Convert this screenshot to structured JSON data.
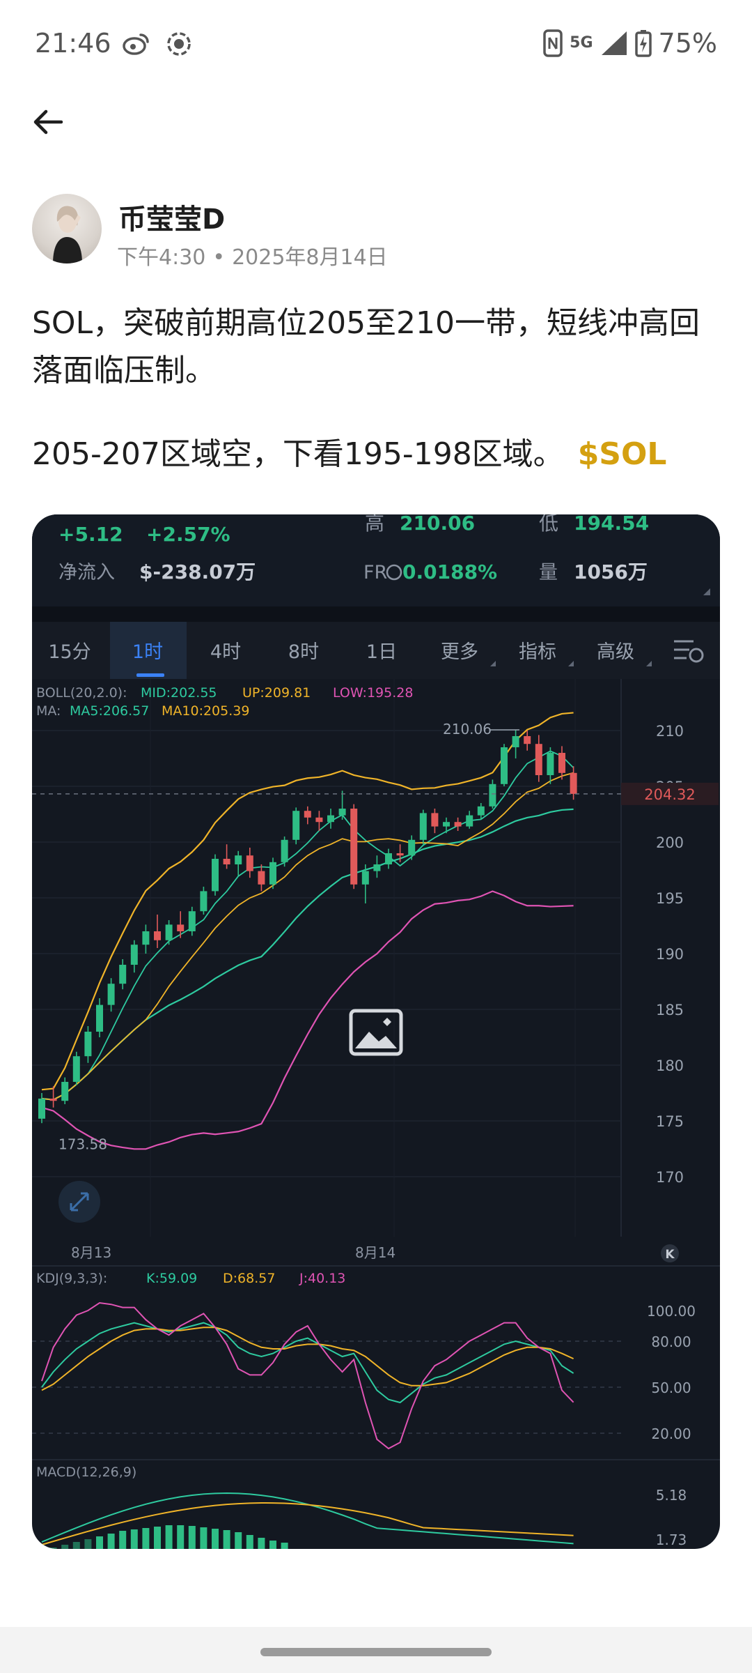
{
  "status_bar": {
    "time": "21:46",
    "network": "5G",
    "battery": "75%"
  },
  "post": {
    "author": "币莹莹D",
    "time": "下午4:30",
    "date": "2025年8月14日",
    "paragraph1": "SOL，突破前期高位205至210一带，短线冲高回落面临压制。",
    "paragraph2": "205-207区域空，下看195-198区域。",
    "ticker": "$SOL"
  },
  "chart": {
    "stats": {
      "change_abs": "+5.12",
      "change_pct": "+2.57%",
      "high_label": "高",
      "high": "210.06",
      "low_label": "低",
      "low": "194.54",
      "netflow_label": "净流入",
      "netflow": "$-238.07万",
      "fr_label": "FR",
      "fr": "0.0188%",
      "vol_label": "量",
      "vol": "1056万"
    },
    "tabs": [
      "15分",
      "1时",
      "4时",
      "8时",
      "1日",
      "更多",
      "指标",
      "高级"
    ],
    "active_tab": "1时",
    "boll": {
      "label": "BOLL(20,2.0):",
      "mid": "MID:202.55",
      "up": "UP:209.81",
      "low": "LOW:195.28"
    },
    "ma": {
      "label": "MA:",
      "ma5": "MA5:206.57",
      "ma10": "MA10:205.39"
    },
    "price_marker": "204.32",
    "high_marker": "210.06",
    "low_marker": "173.58",
    "date_ticks": [
      "8月13",
      "8月14"
    ],
    "kdj": {
      "label": "KDJ(9,3,3):",
      "k": "K:59.09",
      "d": "D:68.57",
      "j": "J:40.13"
    },
    "macd_label": "MACD(12,26,9)",
    "colors": {
      "up": "#2ebd85",
      "down": "#e15a5a",
      "mid": "#2ecba0",
      "upper": "#f0b429",
      "lower": "#e054b4",
      "accent": "#d4a010"
    }
  },
  "chart_data": [
    {
      "type": "candlestick",
      "title": "SOL 1时",
      "ylim": [
        168,
        212
      ],
      "y_ticks": [
        210,
        205,
        200,
        195,
        190,
        185,
        180,
        175,
        170
      ],
      "x_labels": [
        "8月13",
        "8月14"
      ],
      "current_price": 204.32,
      "candles": [
        [
          175.2,
          177.5,
          174.8,
          177.0
        ],
        [
          177.0,
          178.1,
          176.2,
          176.8
        ],
        [
          176.8,
          178.9,
          176.5,
          178.5
        ],
        [
          178.5,
          181.2,
          178.2,
          180.8
        ],
        [
          180.8,
          183.5,
          180.2,
          183.0
        ],
        [
          183.0,
          186.0,
          182.5,
          185.4
        ],
        [
          185.4,
          187.8,
          184.8,
          187.3
        ],
        [
          187.3,
          189.5,
          186.8,
          189.0
        ],
        [
          189.0,
          191.2,
          188.3,
          190.8
        ],
        [
          190.8,
          192.6,
          190.0,
          192.0
        ],
        [
          192.0,
          193.5,
          190.5,
          191.2
        ],
        [
          191.2,
          193.0,
          190.8,
          192.6
        ],
        [
          192.6,
          193.8,
          191.4,
          192.0
        ],
        [
          192.0,
          194.2,
          191.6,
          193.8
        ],
        [
          193.8,
          196.0,
          193.5,
          195.6
        ],
        [
          195.6,
          198.9,
          195.2,
          198.5
        ],
        [
          198.5,
          199.8,
          197.6,
          198.0
        ],
        [
          198.0,
          199.2,
          197.0,
          198.8
        ],
        [
          198.8,
          199.5,
          196.8,
          197.4
        ],
        [
          197.4,
          198.0,
          195.6,
          196.2
        ],
        [
          196.2,
          198.6,
          195.8,
          198.2
        ],
        [
          198.2,
          200.5,
          197.8,
          200.2
        ],
        [
          200.2,
          203.1,
          199.8,
          202.8
        ],
        [
          202.8,
          203.2,
          201.6,
          202.2
        ],
        [
          202.2,
          202.8,
          201.0,
          201.8
        ],
        [
          201.8,
          203.0,
          201.2,
          202.4
        ],
        [
          202.4,
          204.6,
          202.0,
          203.0
        ],
        [
          203.0,
          203.4,
          195.8,
          196.2
        ],
        [
          196.2,
          198.0,
          194.5,
          197.4
        ],
        [
          197.4,
          198.8,
          196.8,
          198.0
        ],
        [
          198.0,
          199.4,
          197.6,
          199.0
        ],
        [
          199.0,
          199.8,
          198.2,
          198.8
        ],
        [
          198.8,
          200.6,
          198.4,
          200.2
        ],
        [
          200.2,
          202.9,
          199.8,
          202.6
        ],
        [
          202.6,
          203.0,
          200.8,
          201.4
        ],
        [
          201.4,
          202.2,
          200.8,
          201.8
        ],
        [
          201.8,
          202.2,
          201.0,
          201.4
        ],
        [
          201.4,
          202.8,
          201.2,
          202.4
        ],
        [
          202.4,
          203.5,
          202.0,
          203.2
        ],
        [
          203.2,
          205.6,
          203.0,
          205.2
        ],
        [
          205.2,
          208.8,
          205.0,
          208.5
        ],
        [
          208.5,
          210.06,
          207.5,
          209.5
        ],
        [
          209.5,
          210.0,
          208.2,
          208.8
        ],
        [
          208.8,
          209.6,
          205.4,
          206.0
        ],
        [
          206.0,
          208.5,
          205.2,
          208.0
        ],
        [
          208.0,
          208.6,
          205.6,
          206.2
        ],
        [
          206.2,
          206.8,
          203.8,
          204.32
        ]
      ]
    },
    {
      "type": "line",
      "title": "KDJ(9,3,3)",
      "ylim": [
        10,
        110
      ],
      "y_ticks": [
        100,
        80,
        50,
        20
      ],
      "series": [
        {
          "name": "K",
          "color": "#2ecba0",
          "values": [
            50,
            60,
            68,
            75,
            80,
            85,
            88,
            90,
            92,
            90,
            88,
            86,
            88,
            90,
            92,
            89,
            84,
            76,
            72,
            70,
            72,
            76,
            80,
            82,
            78,
            74,
            70,
            72,
            60,
            48,
            42,
            40,
            46,
            52,
            56,
            58,
            62,
            66,
            70,
            74,
            78,
            80,
            78,
            76,
            74,
            64,
            59.09
          ]
        },
        {
          "name": "D",
          "color": "#f0b429",
          "values": [
            48,
            52,
            58,
            64,
            70,
            75,
            80,
            84,
            87,
            88,
            88,
            87,
            87,
            88,
            89,
            89,
            87,
            83,
            79,
            76,
            75,
            75,
            77,
            78,
            78,
            77,
            75,
            74,
            70,
            64,
            58,
            53,
            51,
            51,
            52,
            53,
            56,
            59,
            63,
            67,
            71,
            74,
            76,
            76,
            75,
            72,
            68.57
          ]
        },
        {
          "name": "J",
          "color": "#e054b4",
          "values": [
            54,
            76,
            88,
            97,
            100,
            105,
            104,
            102,
            102,
            94,
            88,
            84,
            90,
            94,
            98,
            89,
            78,
            62,
            58,
            58,
            66,
            78,
            86,
            90,
            78,
            68,
            60,
            68,
            40,
            16,
            10,
            14,
            36,
            54,
            64,
            68,
            74,
            80,
            84,
            88,
            92,
            92,
            82,
            76,
            72,
            48,
            40.13
          ]
        }
      ]
    },
    {
      "type": "bar",
      "title": "MACD(12,26,9)",
      "y_ticks": [
        5.18,
        1.73
      ]
    }
  ]
}
